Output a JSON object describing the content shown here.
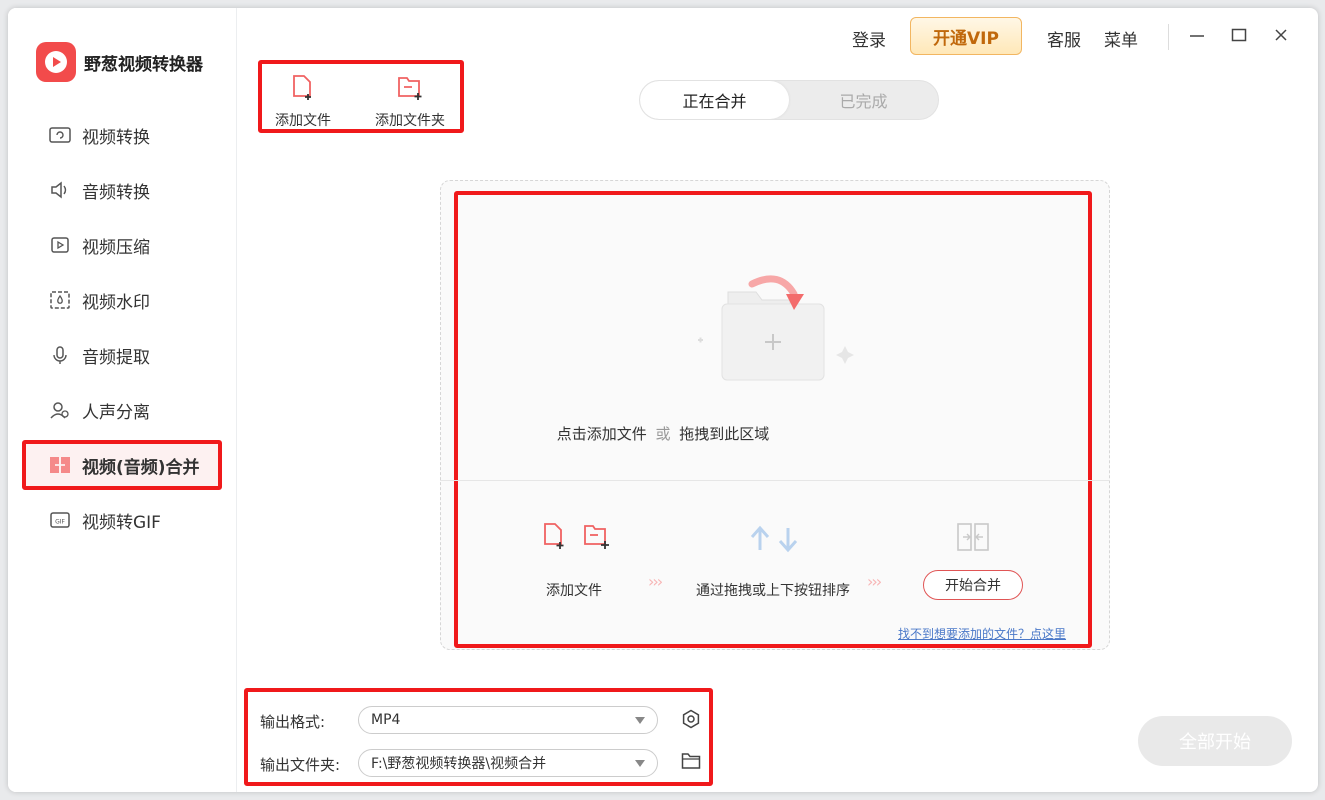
{
  "app": {
    "name": "野葱视频转换器"
  },
  "titlebar": {
    "login": "登录",
    "vip": "开通VIP",
    "support": "客服",
    "menu": "菜单"
  },
  "sidebar": {
    "items": [
      {
        "label": "视频转换",
        "icon": "video-convert-icon"
      },
      {
        "label": "音频转换",
        "icon": "audio-convert-icon"
      },
      {
        "label": "视频压缩",
        "icon": "video-compress-icon"
      },
      {
        "label": "视频水印",
        "icon": "watermark-icon"
      },
      {
        "label": "音频提取",
        "icon": "audio-extract-icon"
      },
      {
        "label": "人声分离",
        "icon": "voice-separate-icon"
      },
      {
        "label": "视频(音频)合并",
        "icon": "merge-icon",
        "active": true
      },
      {
        "label": "视频转GIF",
        "icon": "gif-icon"
      }
    ]
  },
  "toolbar": {
    "add_file": "添加文件",
    "add_folder": "添加文件夹"
  },
  "tabs": {
    "merging": "正在合并",
    "done": "已完成"
  },
  "dropzone": {
    "hint_click": "点击添加文件",
    "hint_or": "或",
    "hint_drag": "拖拽到此区域",
    "step1": "添加文件",
    "step2": "通过拖拽或上下按钮排序",
    "step3": "开始合并",
    "help_link": "找不到想要添加的文件？点这里"
  },
  "output": {
    "format_label": "输出格式:",
    "format_value": "MP4",
    "folder_label": "输出文件夹:",
    "folder_value": "F:\\野葱视频转换器\\视频合并"
  },
  "actions": {
    "start_all": "全部开始"
  },
  "colors": {
    "accent": "#f24b4b",
    "highlight": "#f0191b",
    "vip": "#c0680b"
  }
}
